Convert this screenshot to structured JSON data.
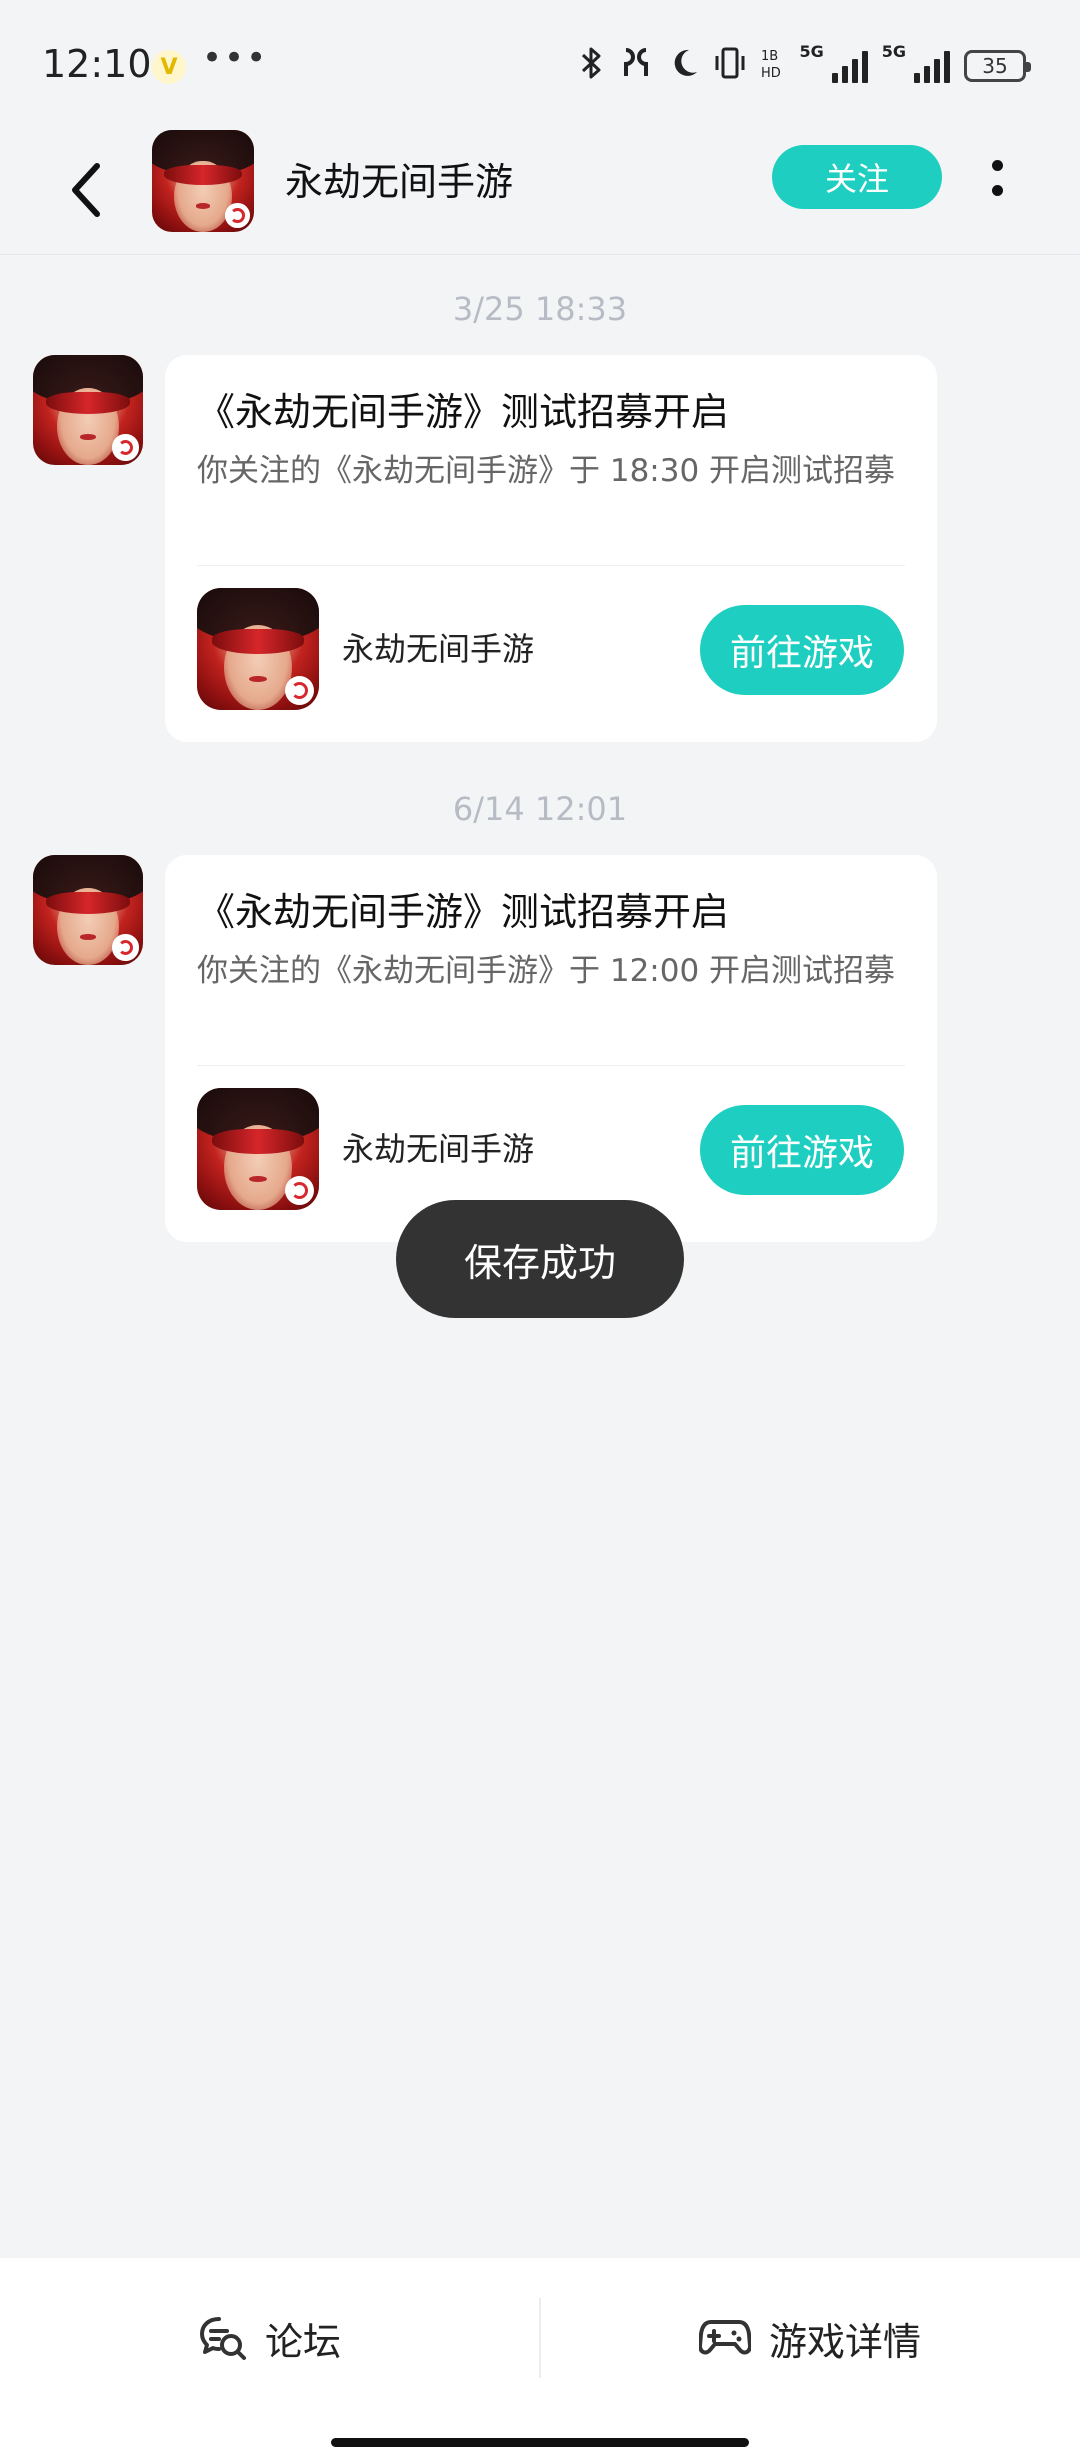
{
  "status_bar": {
    "time": "12:10",
    "app_badge": "V",
    "dots": "•••",
    "network_a": "5G",
    "network_b": "5G",
    "battery": "35"
  },
  "header": {
    "title": "永劫无间手游",
    "follow_label": "关注"
  },
  "messages": [
    {
      "timestamp": "3/25  18:33",
      "title": "《永劫无间手游》测试招募开启",
      "description": "你关注的《永劫无间手游》于 18:30 开启测试招募",
      "game_name": "永劫无间手游",
      "button_label": "前往游戏"
    },
    {
      "timestamp": "6/14  12:01",
      "title": "《永劫无间手游》测试招募开启",
      "description": "你关注的《永劫无间手游》于 12:00 开启测试招募",
      "game_name": "永劫无间手游",
      "button_label": "前往游戏"
    }
  ],
  "toast": {
    "text": "保存成功"
  },
  "bottom_bar": {
    "forum_label": "论坛",
    "details_label": "游戏详情"
  },
  "colors": {
    "accent": "#1ecfc1",
    "background": "#f3f4f6",
    "toast": "#333333"
  }
}
